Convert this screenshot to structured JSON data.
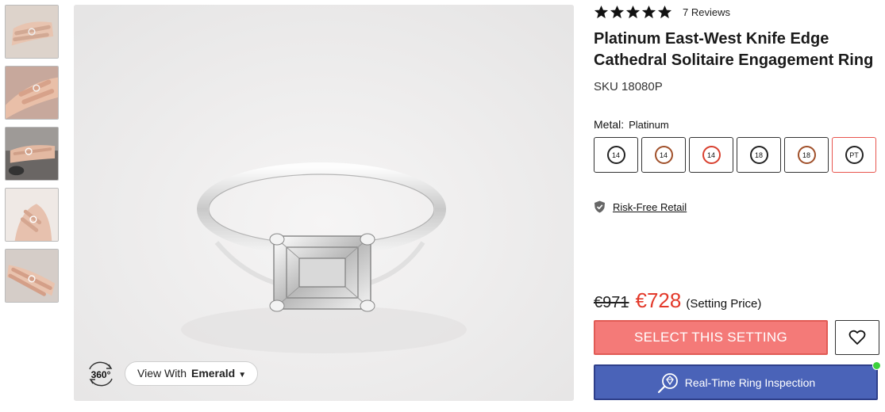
{
  "thumbnails": [
    "hand-ring-thumb-1",
    "hand-ring-thumb-2",
    "hand-ring-thumb-3",
    "hand-ring-thumb-4",
    "hand-ring-thumb-5"
  ],
  "viewer": {
    "rotate_label": "360°",
    "view_with_label": "View With",
    "view_with_shape": "Emerald",
    "caret": "▼"
  },
  "product": {
    "rating_stars": 5,
    "reviews": "7 Reviews",
    "title": "Platinum East-West Knife Edge Cathedral Solitaire Engagement Ring",
    "sku": "SKU 18080P",
    "metal_label": "Metal:",
    "metal_value": "Platinum",
    "metals": [
      {
        "label": "14",
        "color": "#222222"
      },
      {
        "label": "14",
        "color": "#a0502a"
      },
      {
        "label": "14",
        "color": "#d8402f"
      },
      {
        "label": "18",
        "color": "#222222"
      },
      {
        "label": "18",
        "color": "#a0502a"
      },
      {
        "label": "PT",
        "color": "#222222"
      }
    ],
    "selected_metal": "PT",
    "risk_free": "Risk-Free Retail",
    "old_price": "€971",
    "new_price": "€728",
    "price_note": "(Setting Price)",
    "select_button": "SELECT THIS SETTING",
    "inspection_button": "Real-Time Ring Inspection"
  },
  "colors": {
    "sale_red": "#e33a2b",
    "select_button": "#f47a78",
    "inspection_button": "#4a63b8",
    "online": "#3cd13c"
  }
}
